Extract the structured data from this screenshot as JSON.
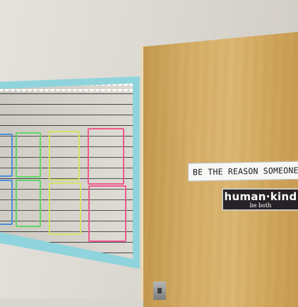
{
  "scene": {
    "wall_color": "#dcd9d2",
    "board_border_color": "#8fd4dc",
    "door_color": "#d7b06a"
  },
  "bulletin_board": {
    "pocket_colors": [
      "#4a8fd9",
      "#63d56a",
      "#d8e26a",
      "#f05a8e",
      "#4a8fd9",
      "#63d56a",
      "#d8e26a",
      "#f05a8e"
    ]
  },
  "door_signs": {
    "smile_sign_text": "BE THE REASON SOMEONE SMIL",
    "human_kind_main": "human·kind",
    "human_kind_sub": "be both"
  }
}
